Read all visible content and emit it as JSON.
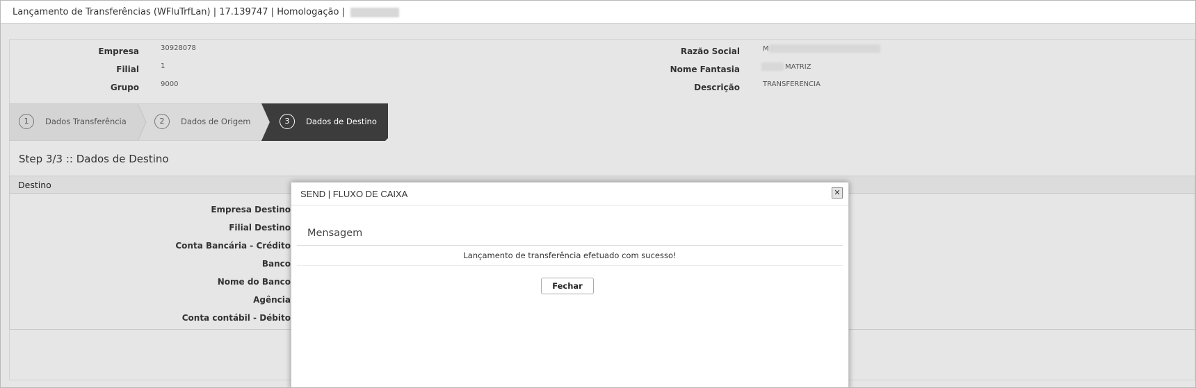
{
  "window": {
    "title": "Lançamento de Transferências (WFluTrfLan) | 17.139747 | Homologação | "
  },
  "header_fields": {
    "empresa": {
      "label": "Empresa",
      "value": "30928078"
    },
    "filial": {
      "label": "Filial",
      "value": "1"
    },
    "grupo": {
      "label": "Grupo",
      "value": "9000"
    },
    "razao_social": {
      "label": "Razão Social",
      "value": "M"
    },
    "nome_fantasia": {
      "label": "Nome Fantasia",
      "value": "MATRIZ"
    },
    "descricao": {
      "label": "Descrição",
      "value": "TRANSFERENCIA"
    }
  },
  "wizard": {
    "steps": [
      {
        "number": "1",
        "label": "Dados Transferência",
        "active": false
      },
      {
        "number": "2",
        "label": "Dados de Origem",
        "active": false
      },
      {
        "number": "3",
        "label": "Dados de Destino",
        "active": true
      }
    ],
    "step_heading": "Step 3/3 :: Dados de Destino"
  },
  "destino": {
    "section_title": "Destino",
    "fields": [
      "Empresa Destino",
      "Filial Destino",
      "Conta Bancária - Crédito",
      "Banco",
      "Nome do Banco",
      "Agência",
      "Conta contábil - Débito"
    ]
  },
  "modal": {
    "title": "SEND | FLUXO DE CAIXA",
    "close_label": "✕",
    "message_title": "Mensagem",
    "message_text": "Lançamento de transferência efetuado com sucesso!",
    "button_label": "Fechar"
  },
  "colors": {
    "background": "#e6e6e6",
    "active_step": "#3c3c3c",
    "inactive_step": "#d4d4d4"
  },
  "icons": {
    "close": "close-icon"
  }
}
